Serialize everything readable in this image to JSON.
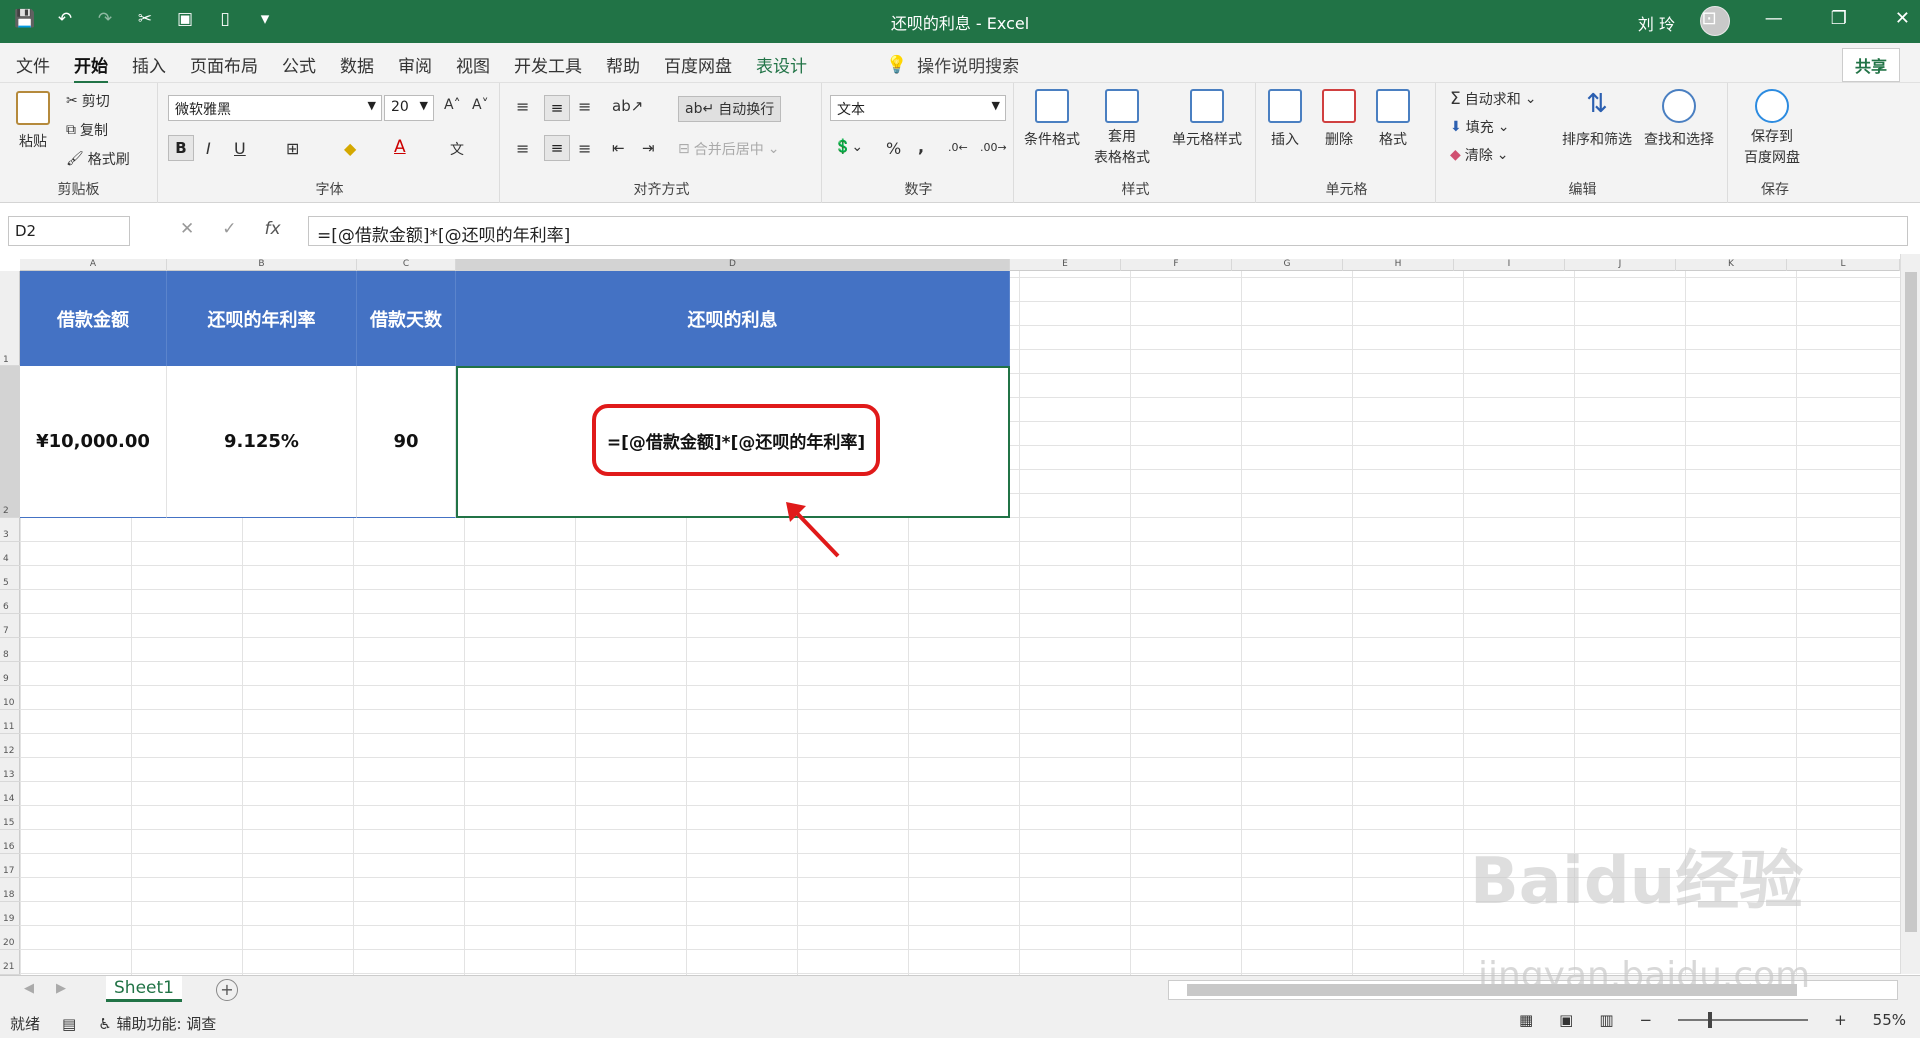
{
  "window": {
    "title": "还呗的利息  -  Excel",
    "user": "刘 玲"
  },
  "menu": {
    "items": [
      "文件",
      "开始",
      "插入",
      "页面布局",
      "公式",
      "数据",
      "审阅",
      "视图",
      "开发工具",
      "帮助",
      "百度网盘",
      "表设计"
    ],
    "active": "开始",
    "tell_me": "操作说明搜索",
    "share": "共享"
  },
  "ribbon": {
    "clipboard": {
      "paste": "粘贴",
      "cut": "剪切",
      "copy": "复制",
      "format_painter": "格式刷",
      "label": "剪贴板"
    },
    "font": {
      "name": "微软雅黑",
      "size": "20",
      "label": "字体"
    },
    "alignment": {
      "wrap": "自动换行",
      "merge": "合并后居中",
      "label": "对齐方式"
    },
    "number": {
      "format": "文本",
      "percent": "%",
      "comma": ",",
      "label": "数字"
    },
    "styles": {
      "conditional": "条件格式",
      "table_line1": "套用",
      "table_line2": "表格格式",
      "cell_styles": "单元格样式",
      "label": "样式"
    },
    "cells": {
      "insert": "插入",
      "delete": "删除",
      "format": "格式",
      "label": "单元格"
    },
    "editing": {
      "autosum": "自动求和",
      "fill": "填充",
      "clear": "清除",
      "sort": "排序和筛选",
      "find": "查找和选择",
      "label": "编辑"
    },
    "save": {
      "line1": "保存到",
      "line2": "百度网盘",
      "label": "保存"
    }
  },
  "formula_bar": {
    "name_box": "D2",
    "formula": "=[@借款金额]*[@还呗的年利率]"
  },
  "columns": [
    "A",
    "B",
    "C",
    "D",
    "E",
    "F",
    "G",
    "H",
    "I",
    "J",
    "K",
    "L"
  ],
  "rows": [
    "1",
    "2",
    "3",
    "4",
    "5",
    "6",
    "7",
    "8",
    "9",
    "10",
    "11",
    "12",
    "13",
    "14",
    "15",
    "16",
    "17",
    "18",
    "19",
    "20",
    "21"
  ],
  "table": {
    "headers": [
      "借款金额",
      "还呗的年利率",
      "借款天数",
      "还呗的利息"
    ],
    "row": [
      "¥10,000.00",
      "9.125%",
      "90",
      "=[@借款金额]*[@还呗的年利率]"
    ]
  },
  "sheets": {
    "active": "Sheet1"
  },
  "status": {
    "ready": "就绪",
    "accessibility": "辅助功能: 调查",
    "zoom": "55%"
  },
  "watermark": {
    "logo": "Baidu经验",
    "url": "jingyan.baidu.com"
  },
  "colors": {
    "excel_green": "#217346",
    "table_header": "#4472c4",
    "callout": "#e01a1a"
  }
}
